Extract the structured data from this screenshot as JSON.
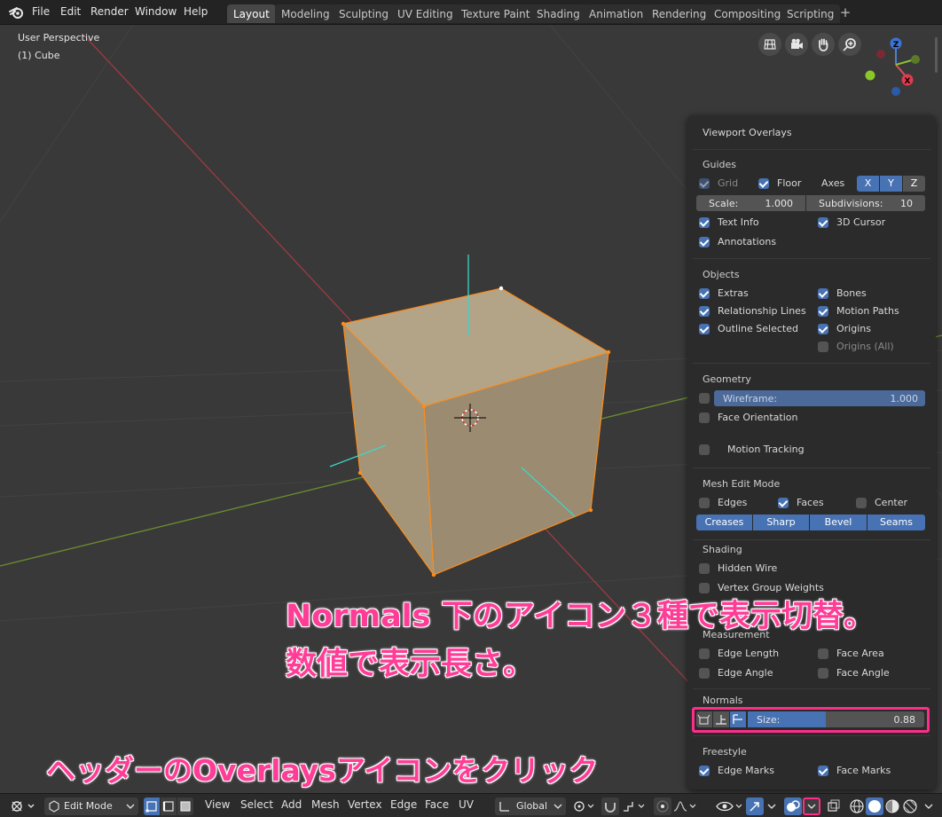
{
  "menu": [
    "File",
    "Edit",
    "Render",
    "Window",
    "Help"
  ],
  "workspaces": [
    {
      "label": "Layout",
      "active": true
    },
    {
      "label": "Modeling",
      "active": false
    },
    {
      "label": "Sculpting",
      "active": false
    },
    {
      "label": "UV Editing",
      "active": false
    },
    {
      "label": "Texture Paint",
      "active": false
    },
    {
      "label": "Shading",
      "active": false
    },
    {
      "label": "Animation",
      "active": false
    },
    {
      "label": "Rendering",
      "active": false
    },
    {
      "label": "Compositing",
      "active": false
    },
    {
      "label": "Scripting",
      "active": false
    }
  ],
  "workspace_add": "+",
  "viewport": {
    "view_name": "User Perspective",
    "object_name": "(1) Cube"
  },
  "gizmo": {
    "z": "Z",
    "x": "X"
  },
  "overlays": {
    "title": "Viewport Overlays",
    "guides": {
      "title": "Guides",
      "grid": "Grid",
      "floor": "Floor",
      "axes": "Axes",
      "axis_x": "X",
      "axis_y": "Y",
      "axis_z": "Z",
      "scale_label": "Scale:",
      "scale_value": "1.000",
      "subdiv_label": "Subdivisions:",
      "subdiv_value": "10",
      "text_info": "Text Info",
      "cursor_3d": "3D Cursor",
      "annotations": "Annotations"
    },
    "objects": {
      "title": "Objects",
      "extras": "Extras",
      "bones": "Bones",
      "relationship_lines": "Relationship Lines",
      "motion_paths": "Motion Paths",
      "outline_selected": "Outline Selected",
      "origins": "Origins",
      "origins_all": "Origins (All)"
    },
    "geometry": {
      "title": "Geometry",
      "wireframe_label": "Wireframe:",
      "wireframe_value": "1.000",
      "face_orientation": "Face Orientation",
      "motion_tracking": "Motion Tracking"
    },
    "mesh_edit": {
      "title": "Mesh Edit Mode",
      "edges": "Edges",
      "faces": "Faces",
      "center": "Center",
      "creases": "Creases",
      "sharp": "Sharp",
      "bevel": "Bevel",
      "seams": "Seams"
    },
    "shading": {
      "title": "Shading",
      "hidden_wire": "Hidden Wire",
      "vertex_group_weights": "Vertex Group Weights"
    },
    "measurement": {
      "title": "Measurement",
      "edge_length": "Edge Length",
      "face_area": "Face Area",
      "edge_angle": "Edge Angle",
      "face_angle": "Face Angle"
    },
    "normals": {
      "title": "Normals",
      "size_label": "Size:",
      "size_value": "0.88",
      "size_fraction": 0.44
    },
    "freestyle": {
      "title": "Freestyle",
      "edge_marks": "Edge Marks",
      "face_marks": "Face Marks"
    }
  },
  "header": {
    "mode": "Edit Mode",
    "view": "View",
    "select": "Select",
    "add": "Add",
    "mesh": "Mesh",
    "vertex": "Vertex",
    "edge": "Edge",
    "face": "Face",
    "uv": "UV",
    "orientation": "Global"
  },
  "annotations": {
    "line1": "Normals 下のアイコン３種で表示切替。",
    "line2": "数値で表示長さ。",
    "line3": "ヘッダーのOverlaysアイコンをクリック"
  },
  "colors": {
    "accent": "#4772b3",
    "annotation": "#ff3d97",
    "panel_bg": "#2b2b2b",
    "viewport_bg": "#393939",
    "cube_face": "#a39378",
    "selection": "#ff8c1a",
    "x_axis": "#c8323c",
    "y_axis": "#7db32a",
    "normals": "#3ed6c8"
  }
}
